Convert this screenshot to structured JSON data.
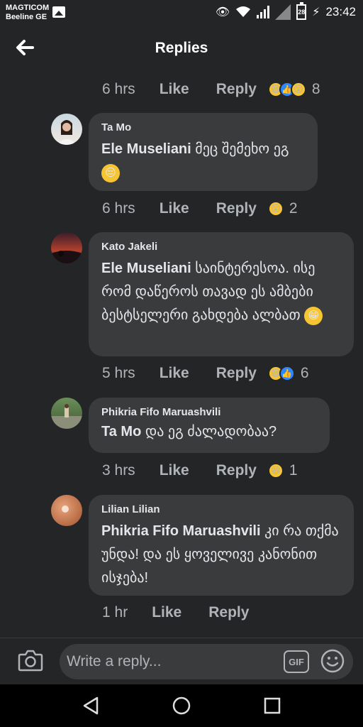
{
  "status_bar": {
    "carrier_line1": "MAGTICOM",
    "carrier_line2": "Beeline GE",
    "battery": "28",
    "time": "23:42"
  },
  "header": {
    "title": "Replies"
  },
  "top_actions": {
    "time": "6 hrs",
    "like": "Like",
    "reply": "Reply",
    "reaction_count": "8"
  },
  "comments": [
    {
      "author": "Ta Mo",
      "mention": "Ele Museliani",
      "text": "მეც შემეხო ეგ",
      "emoji": "😔",
      "time": "6 hrs",
      "like": "Like",
      "reply": "Reply",
      "reaction_count": "2"
    },
    {
      "author": "Kato Jakeli",
      "mention": "Ele Museliani",
      "text": "საინტერესოა. ისე რომ დაწეროს თავად ეს ამბები ბესტსელერი გახდება ალბათ",
      "emoji": "😁",
      "time": "5 hrs",
      "like": "Like",
      "reply": "Reply",
      "reaction_count": "6"
    },
    {
      "author": "Phikria Fifo Maruashvili",
      "mention": "Ta Mo",
      "text": "და ეგ ძალადობაა?",
      "time": "3 hrs",
      "like": "Like",
      "reply": "Reply",
      "reaction_count": "1"
    },
    {
      "author": "Lilian Lilian",
      "mention": "Phikria Fifo Maruashvili",
      "text": "კი რა თქმა უნდა! და ეს ყოველივე კანონით ისჯება!",
      "time": "1 hr",
      "like": "Like",
      "reply": "Reply"
    }
  ],
  "composer": {
    "placeholder": "Write a reply...",
    "gif_label": "GIF"
  },
  "colors": {
    "background": "#242526",
    "bubble": "#3a3b3c",
    "muted": "#b0b3b8",
    "like_blue": "#2d88ff",
    "emoji_yellow": "#f7c531"
  }
}
